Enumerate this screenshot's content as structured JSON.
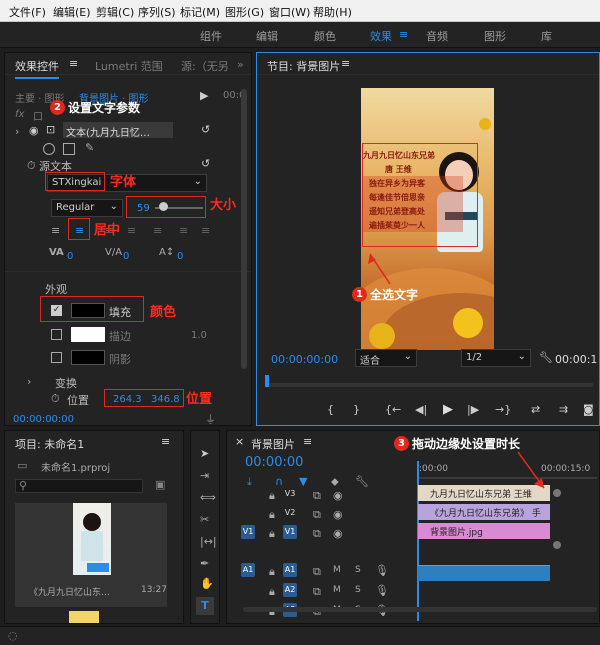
{
  "menu": [
    "文件(F)",
    "编辑(E)",
    "剪辑(C)",
    "序列(S)",
    "标记(M)",
    "图形(G)",
    "窗口(W)",
    "帮助(H)"
  ],
  "workspaces": [
    "组件",
    "编辑",
    "颜色",
    "效果",
    "音频",
    "图形",
    "库"
  ],
  "workspace_active_index": 3,
  "effect_controls": {
    "tabs": [
      "效果控件",
      "Lumetri 范围",
      "源:（无另"
    ],
    "row_master": "主要 · 图形",
    "row_seq": "背景图片 · 图形",
    "timecode": "00:0",
    "fx_label": "fx",
    "fx_row": "口",
    "text_layer": "文本(九月九日忆…",
    "source_text": "源文本",
    "font": "STXingkai",
    "style": "Regular",
    "size": "59",
    "tracking": "0",
    "kerning": "0",
    "appearance": "外观",
    "fill": "填充",
    "stroke": "描边",
    "stroke_width": "1.0",
    "shadow": "阴影",
    "transform": "变换",
    "position_label": "位置",
    "pos_x": "264.3",
    "pos_y": "346.8",
    "bottom_timecode": "00:00:00:00"
  },
  "program": {
    "title": "节目: 背景图片",
    "timecode": "00:00:00:00",
    "timecode_right": "00:00:1",
    "fit": "适合",
    "quality": "1/2",
    "poem": [
      "九月九日忆山东兄弟",
      "唐 王维",
      "独在异乡为异客",
      "每逢佳节倍思亲",
      "遥知兄弟登高处",
      "遍插茱萸少一人"
    ],
    "transport": [
      "{",
      "}",
      "{←",
      "◀|",
      "▶",
      "|▶",
      "→}",
      "⇄",
      "⇉"
    ]
  },
  "project": {
    "title": "项目: 未命名1",
    "file": "未命名1.prproj",
    "clip_label": "《九月九日忆山东…",
    "clip_dur": "13:27"
  },
  "timeline": {
    "title": "背景图片",
    "timecode": "00:00:00",
    "ruler": [
      ":00:00",
      "00:00:15:0"
    ],
    "tracks": [
      "V3",
      "V2",
      "V1",
      "A1",
      "A2",
      "A3"
    ],
    "src_v": "V1",
    "src_a": "A1",
    "clip_v3": "九月九日忆山东兄弟 王维",
    "clip_v2": "《九月九日忆山东兄弟》 手",
    "clip_v1": "背景图片.jpg"
  },
  "annotations": {
    "a1": "全选文字",
    "a2": "设置文字参数",
    "a3": "拖动边缘处设置时长",
    "font": "字体",
    "size": "大小",
    "center": "居中",
    "color": "颜色",
    "pos": "位置",
    "n1": "1",
    "n2": "2",
    "n3": "3"
  },
  "colors": {
    "accent": "#2d8ceb",
    "annotation": "#e0281c",
    "clip_video": "#d98ad3",
    "clip_text": "#b9a3dc",
    "clip_audio": "#2e7fc0"
  }
}
